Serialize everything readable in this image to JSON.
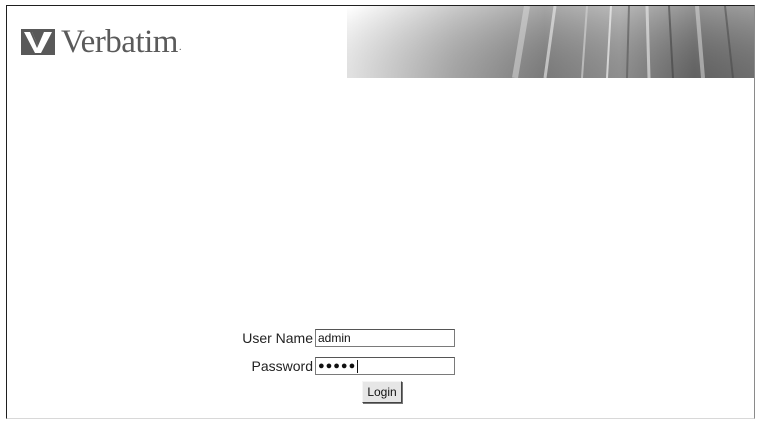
{
  "brand": {
    "name": "Verbatim",
    "trademark_dot": "."
  },
  "login_form": {
    "username_label": "User Name",
    "username_value": "admin",
    "password_label": "Password",
    "password_masked": "●●●●●",
    "login_button_label": "Login"
  },
  "colors": {
    "logo_gray": "#5a5a5a",
    "background": "#ffffff"
  }
}
